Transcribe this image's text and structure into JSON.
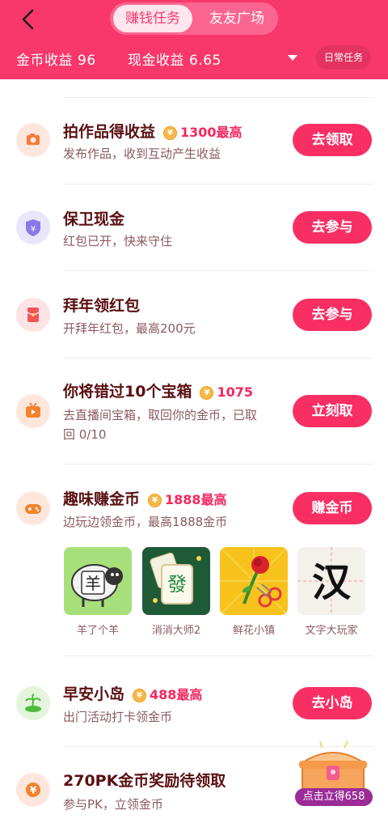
{
  "header": {
    "tabs": [
      {
        "label": "赚钱任务",
        "active": true
      },
      {
        "label": "友友广场",
        "active": false
      }
    ],
    "coin_income_label": "金币收益",
    "coin_income_value": "96",
    "cash_income_label": "现金收益",
    "cash_income_value": "6.65",
    "daily_tasks_label": "日常任务"
  },
  "tasks": [
    {
      "title": "拍作品得收益",
      "reward": "1300最高",
      "subtitle": "发布作品，收到互动产生收益",
      "button": "去领取",
      "icon": "camera-icon"
    },
    {
      "title": "保卫现金",
      "reward": "",
      "subtitle": "红包已开，快来守住",
      "button": "去参与",
      "icon": "shield-yuan-icon"
    },
    {
      "title": "拜年领红包",
      "reward": "",
      "subtitle": "开拜年红包，最高200元",
      "button": "去参与",
      "icon": "red-envelope-icon"
    },
    {
      "title": "你将错过10个宝箱",
      "reward": "1075",
      "subtitle_line1": "去直播间宝箱，取回你的金币，已取",
      "subtitle_line2": "回 0/10",
      "button": "立刻取",
      "icon": "tv-icon"
    },
    {
      "title": "趣味赚金币",
      "reward": "1888最高",
      "subtitle": "边玩边领金币，最高1888金币",
      "button": "赚金币",
      "icon": "gamepad-icon"
    },
    {
      "title": "早安小岛",
      "reward": "488最高",
      "subtitle": "出门活动打卡领金币",
      "button": "去小岛",
      "icon": "island-icon"
    },
    {
      "title": "270PK金币奖励待领取",
      "reward": "",
      "subtitle": "参与PK，立领金币",
      "button": "",
      "icon": "yuan-coin-icon"
    }
  ],
  "games": [
    {
      "name": "羊了个羊",
      "glyph": "羊",
      "bg": "#a7e07a"
    },
    {
      "name": "消消大师2",
      "glyph": "發",
      "bg": "#1f5a37"
    },
    {
      "name": "鲜花小镇",
      "glyph": "",
      "bg": "#f7c21b"
    },
    {
      "name": "文字大玩家",
      "glyph": "汉",
      "bg": "#f4f0ea"
    }
  ],
  "coin_symbol": "¥",
  "chest": {
    "label": "点击立得658"
  },
  "colors": {
    "accent": "#f8386a",
    "button": "#f92f64",
    "title": "#5a1013",
    "subtitle": "#8b5a5e",
    "reward": "#f3285e"
  }
}
